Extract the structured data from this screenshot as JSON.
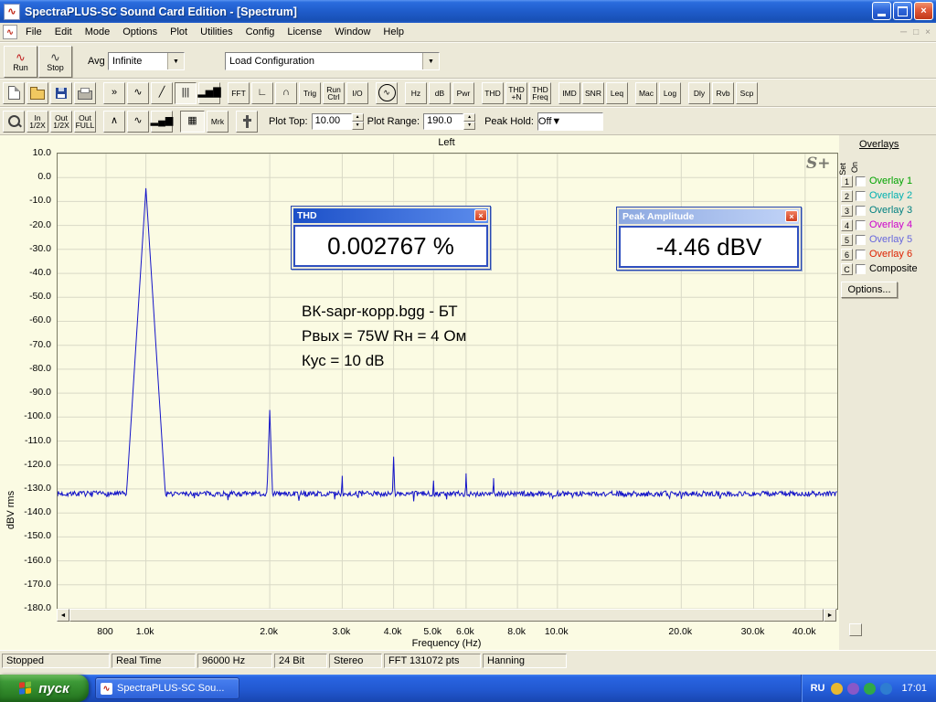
{
  "window": {
    "title": "SpectraPLUS-SC Sound Card Edition - [Spectrum]"
  },
  "menu": {
    "items": [
      "File",
      "Edit",
      "Mode",
      "Options",
      "Plot",
      "Utilities",
      "Config",
      "License",
      "Window",
      "Help"
    ]
  },
  "toolbar1": {
    "run": "Run",
    "stop": "Stop",
    "avg_label": "Avg",
    "avg_value": "Infinite",
    "load_config": "Load Configuration"
  },
  "toolbar2": [
    [
      {
        "name": "new-file-button",
        "icon": "page"
      },
      {
        "name": "open-file-button",
        "icon": "folder"
      },
      {
        "name": "save-button",
        "icon": "floppy"
      },
      {
        "name": "print-button",
        "icon": "printer"
      }
    ],
    [
      {
        "name": "replay-button",
        "glyph": "»"
      },
      {
        "name": "time-series-view-button",
        "glyph": "∿"
      },
      {
        "name": "phase-view-button",
        "glyph": "╱"
      },
      {
        "name": "spectrum-view-button",
        "glyph": "|||",
        "pressed": true
      },
      {
        "name": "spectrogram-view-button",
        "glyph": "▂▅▇"
      }
    ],
    [
      {
        "name": "fft-settings-button",
        "label": "FFT"
      },
      {
        "name": "scaling-button",
        "glyph": "∟"
      },
      {
        "name": "smoothing-window-button",
        "glyph": "∩"
      },
      {
        "name": "trigger-button",
        "label": "Trig"
      },
      {
        "name": "run-control-button",
        "label": "Run\nCtrl"
      },
      {
        "name": "io-device-button",
        "label": "I/O"
      }
    ],
    [
      {
        "name": "signal-generator-button",
        "icon": "gen"
      }
    ],
    [
      {
        "name": "units-hz-button",
        "label": "Hz"
      },
      {
        "name": "units-db-button",
        "label": "dB"
      },
      {
        "name": "units-pwr-button",
        "label": "Pwr"
      }
    ],
    [
      {
        "name": "thd-button",
        "label": "THD"
      },
      {
        "name": "thd-plus-n-button",
        "label": "THD\n+N"
      },
      {
        "name": "thd-freq-button",
        "label": "THD\nFreq"
      }
    ],
    [
      {
        "name": "imd-button",
        "label": "IMD"
      },
      {
        "name": "snr-button",
        "label": "SNR"
      },
      {
        "name": "leq-button",
        "label": "Leq"
      }
    ],
    [
      {
        "name": "macro-button",
        "label": "Mac"
      },
      {
        "name": "logging-button",
        "label": "Log"
      }
    ],
    [
      {
        "name": "delay-button",
        "label": "Dly"
      },
      {
        "name": "reverb-button",
        "label": "Rvb"
      },
      {
        "name": "scope-button",
        "label": "Scp"
      }
    ]
  ],
  "toolbar3": {
    "buttons": [
      [
        {
          "name": "zoom-button",
          "icon": "zoom"
        },
        {
          "name": "zoom-in-half-button",
          "label": "In\n1/2X"
        },
        {
          "name": "zoom-out-half-button",
          "label": "Out\n1/2X"
        },
        {
          "name": "zoom-out-full-button",
          "label": "Out\nFULL"
        }
      ],
      [
        {
          "name": "peak-cursor-button",
          "glyph": "∧"
        },
        {
          "name": "curve-display-button",
          "glyph": "∿"
        },
        {
          "name": "bar-display-button",
          "glyph": "▂▄▆"
        }
      ],
      [
        {
          "name": "table-view-button",
          "glyph": "▦",
          "pressed": true,
          "w": 27
        },
        {
          "name": "marker-button",
          "label": "Mrk"
        }
      ],
      [
        {
          "name": "slider-button",
          "icon": "vslider"
        }
      ]
    ],
    "plot_top_label": "Plot Top:",
    "plot_top_value": "10.00",
    "plot_range_label": "Plot Range:",
    "plot_range_value": "190.0",
    "peak_hold_label": "Peak Hold:",
    "peak_hold_value": "Off"
  },
  "chart_data": {
    "type": "line",
    "title": "Left",
    "xlabel": "Frequency (Hz)",
    "ylabel": "dBV rms",
    "x_scale": "log",
    "x_range_hz": [
      610,
      47900
    ],
    "y_range_db": [
      -180,
      10
    ],
    "grid": true,
    "plot_bg": "#FBFBE3",
    "grid_color": "#D9D9C6",
    "trace_color": "#1414C8",
    "y_ticks": [
      "10.0",
      "0.0",
      "-10.0",
      "-20.0",
      "-30.0",
      "-40.0",
      "-50.0",
      "-60.0",
      "-70.0",
      "-80.0",
      "-90.0",
      "-100.0",
      "-110.0",
      "-120.0",
      "-130.0",
      "-140.0",
      "-150.0",
      "-160.0",
      "-170.0",
      "-180.0"
    ],
    "x_ticks": [
      {
        "hz": 800,
        "label": "800"
      },
      {
        "hz": 1000,
        "label": "1.0k"
      },
      {
        "hz": 2000,
        "label": "2.0k"
      },
      {
        "hz": 3000,
        "label": "3.0k"
      },
      {
        "hz": 4000,
        "label": "4.0k"
      },
      {
        "hz": 5000,
        "label": "5.0k"
      },
      {
        "hz": 6000,
        "label": "6.0k"
      },
      {
        "hz": 8000,
        "label": "8.0k"
      },
      {
        "hz": 10000,
        "label": "10.0k"
      },
      {
        "hz": 20000,
        "label": "20.0k"
      },
      {
        "hz": 30000,
        "label": "30.0k"
      },
      {
        "hz": 40000,
        "label": "40.0k"
      }
    ],
    "noise_floor_db": -132,
    "noise_ripple_db": 1.1,
    "peaks": [
      {
        "hz": 1000,
        "db": -4.46,
        "slope_db_per_decade": 2700
      },
      {
        "hz": 2000,
        "db": -97,
        "slope_db_per_decade": 5200
      },
      {
        "hz": 3000,
        "db": -124.5,
        "slope_db_per_decade": 5200
      },
      {
        "hz": 4000,
        "db": -116.5,
        "slope_db_per_decade": 5200
      },
      {
        "hz": 5000,
        "db": -126.5,
        "slope_db_per_decade": 5200
      },
      {
        "hz": 6000,
        "db": -123.5,
        "slope_db_per_decade": 5200
      },
      {
        "hz": 7000,
        "db": -125.5,
        "slope_db_per_decade": 5200
      }
    ]
  },
  "thd_window": {
    "title": "THD",
    "value": "0.002767 %"
  },
  "peak_window": {
    "title": "Peak Amplitude",
    "value": "-4.46 dBV"
  },
  "annotation": {
    "lines": [
      "ВК-sapr-корр.bgg - БТ",
      "Рвых = 75W   Rн = 4 Ом",
      "Кус = 10 dB"
    ]
  },
  "logo": "S+",
  "overlays": {
    "title": "Overlays",
    "col_set": "Set",
    "col_on": "On",
    "rows": [
      {
        "key": "1",
        "label": "Overlay 1",
        "color": "#00A300"
      },
      {
        "key": "2",
        "label": "Overlay 2",
        "color": "#00B0B0"
      },
      {
        "key": "3",
        "label": "Overlay 3",
        "color": "#008080"
      },
      {
        "key": "4",
        "label": "Overlay 4",
        "color": "#CC00CC"
      },
      {
        "key": "5",
        "label": "Overlay 5",
        "color": "#6666DD"
      },
      {
        "key": "6",
        "label": "Overlay 6",
        "color": "#DD2200"
      },
      {
        "key": "C",
        "label": "Composite",
        "color": "#000000"
      }
    ],
    "options_label": "Options..."
  },
  "statusbar": {
    "cells": [
      "Stopped",
      "Real Time",
      "96000 Hz",
      "24 Bit",
      "Stereo",
      "FFT 131072 pts",
      "Hanning"
    ],
    "widths": [
      118,
      92,
      82,
      58,
      58,
      106,
      92
    ]
  },
  "taskbar": {
    "start": "пуск",
    "task": "SpectraPLUS-SC Sou...",
    "lang": "RU",
    "time": "17:01",
    "tray_icon_colors": [
      "#E8B830",
      "#8858C8",
      "#30A848",
      "#2E7DD1"
    ]
  },
  "icons": {
    "minimize-icon": "bar",
    "restore-icon": "window",
    "close-icon": "×",
    "dropdown-arrow-icon": "▼",
    "spin-up-icon": "▲",
    "spin-down-icon": "▼",
    "scroll-left-icon": "◄",
    "scroll-right-icon": "►"
  }
}
